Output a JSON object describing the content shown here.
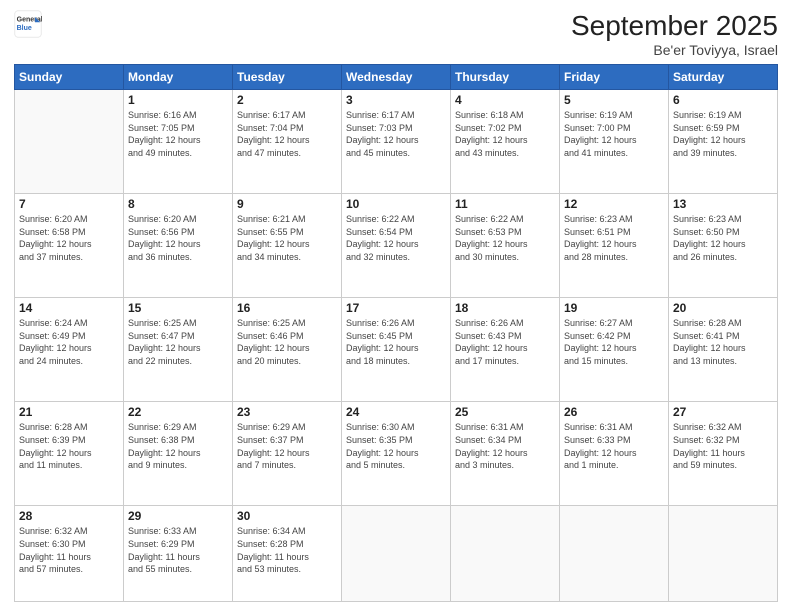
{
  "header": {
    "logo_line1": "General",
    "logo_line2": "Blue",
    "title": "September 2025",
    "subtitle": "Be'er Toviyya, Israel"
  },
  "days_of_week": [
    "Sunday",
    "Monday",
    "Tuesday",
    "Wednesday",
    "Thursday",
    "Friday",
    "Saturday"
  ],
  "weeks": [
    [
      {
        "day": "",
        "info": ""
      },
      {
        "day": "1",
        "info": "Sunrise: 6:16 AM\nSunset: 7:05 PM\nDaylight: 12 hours\nand 49 minutes."
      },
      {
        "day": "2",
        "info": "Sunrise: 6:17 AM\nSunset: 7:04 PM\nDaylight: 12 hours\nand 47 minutes."
      },
      {
        "day": "3",
        "info": "Sunrise: 6:17 AM\nSunset: 7:03 PM\nDaylight: 12 hours\nand 45 minutes."
      },
      {
        "day": "4",
        "info": "Sunrise: 6:18 AM\nSunset: 7:02 PM\nDaylight: 12 hours\nand 43 minutes."
      },
      {
        "day": "5",
        "info": "Sunrise: 6:19 AM\nSunset: 7:00 PM\nDaylight: 12 hours\nand 41 minutes."
      },
      {
        "day": "6",
        "info": "Sunrise: 6:19 AM\nSunset: 6:59 PM\nDaylight: 12 hours\nand 39 minutes."
      }
    ],
    [
      {
        "day": "7",
        "info": "Sunrise: 6:20 AM\nSunset: 6:58 PM\nDaylight: 12 hours\nand 37 minutes."
      },
      {
        "day": "8",
        "info": "Sunrise: 6:20 AM\nSunset: 6:56 PM\nDaylight: 12 hours\nand 36 minutes."
      },
      {
        "day": "9",
        "info": "Sunrise: 6:21 AM\nSunset: 6:55 PM\nDaylight: 12 hours\nand 34 minutes."
      },
      {
        "day": "10",
        "info": "Sunrise: 6:22 AM\nSunset: 6:54 PM\nDaylight: 12 hours\nand 32 minutes."
      },
      {
        "day": "11",
        "info": "Sunrise: 6:22 AM\nSunset: 6:53 PM\nDaylight: 12 hours\nand 30 minutes."
      },
      {
        "day": "12",
        "info": "Sunrise: 6:23 AM\nSunset: 6:51 PM\nDaylight: 12 hours\nand 28 minutes."
      },
      {
        "day": "13",
        "info": "Sunrise: 6:23 AM\nSunset: 6:50 PM\nDaylight: 12 hours\nand 26 minutes."
      }
    ],
    [
      {
        "day": "14",
        "info": "Sunrise: 6:24 AM\nSunset: 6:49 PM\nDaylight: 12 hours\nand 24 minutes."
      },
      {
        "day": "15",
        "info": "Sunrise: 6:25 AM\nSunset: 6:47 PM\nDaylight: 12 hours\nand 22 minutes."
      },
      {
        "day": "16",
        "info": "Sunrise: 6:25 AM\nSunset: 6:46 PM\nDaylight: 12 hours\nand 20 minutes."
      },
      {
        "day": "17",
        "info": "Sunrise: 6:26 AM\nSunset: 6:45 PM\nDaylight: 12 hours\nand 18 minutes."
      },
      {
        "day": "18",
        "info": "Sunrise: 6:26 AM\nSunset: 6:43 PM\nDaylight: 12 hours\nand 17 minutes."
      },
      {
        "day": "19",
        "info": "Sunrise: 6:27 AM\nSunset: 6:42 PM\nDaylight: 12 hours\nand 15 minutes."
      },
      {
        "day": "20",
        "info": "Sunrise: 6:28 AM\nSunset: 6:41 PM\nDaylight: 12 hours\nand 13 minutes."
      }
    ],
    [
      {
        "day": "21",
        "info": "Sunrise: 6:28 AM\nSunset: 6:39 PM\nDaylight: 12 hours\nand 11 minutes."
      },
      {
        "day": "22",
        "info": "Sunrise: 6:29 AM\nSunset: 6:38 PM\nDaylight: 12 hours\nand 9 minutes."
      },
      {
        "day": "23",
        "info": "Sunrise: 6:29 AM\nSunset: 6:37 PM\nDaylight: 12 hours\nand 7 minutes."
      },
      {
        "day": "24",
        "info": "Sunrise: 6:30 AM\nSunset: 6:35 PM\nDaylight: 12 hours\nand 5 minutes."
      },
      {
        "day": "25",
        "info": "Sunrise: 6:31 AM\nSunset: 6:34 PM\nDaylight: 12 hours\nand 3 minutes."
      },
      {
        "day": "26",
        "info": "Sunrise: 6:31 AM\nSunset: 6:33 PM\nDaylight: 12 hours\nand 1 minute."
      },
      {
        "day": "27",
        "info": "Sunrise: 6:32 AM\nSunset: 6:32 PM\nDaylight: 11 hours\nand 59 minutes."
      }
    ],
    [
      {
        "day": "28",
        "info": "Sunrise: 6:32 AM\nSunset: 6:30 PM\nDaylight: 11 hours\nand 57 minutes."
      },
      {
        "day": "29",
        "info": "Sunrise: 6:33 AM\nSunset: 6:29 PM\nDaylight: 11 hours\nand 55 minutes."
      },
      {
        "day": "30",
        "info": "Sunrise: 6:34 AM\nSunset: 6:28 PM\nDaylight: 11 hours\nand 53 minutes."
      },
      {
        "day": "",
        "info": ""
      },
      {
        "day": "",
        "info": ""
      },
      {
        "day": "",
        "info": ""
      },
      {
        "day": "",
        "info": ""
      }
    ]
  ]
}
